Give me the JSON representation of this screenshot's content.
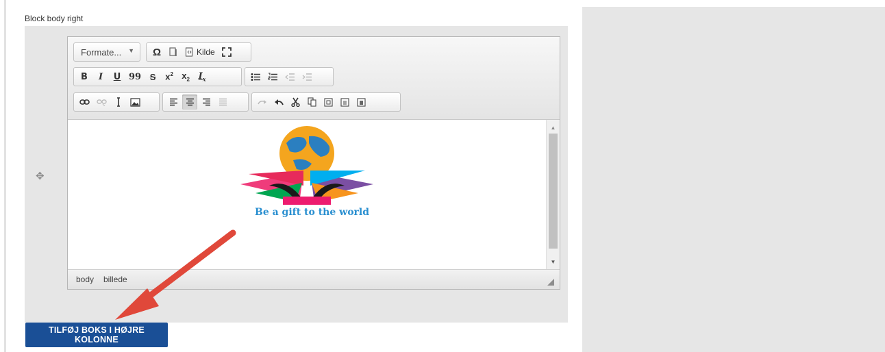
{
  "field_label": "Block body right",
  "toolbar": {
    "format_combo": "Formate...",
    "source_label": "Kilde",
    "row1": [
      "Ω",
      "⎗",
      "⛶"
    ],
    "row2": [
      "B",
      "I",
      "U",
      "99",
      "S",
      "x²",
      "x₂",
      "Ix"
    ],
    "row3": [
      "🔗",
      "⊘",
      "⚓",
      "🖼"
    ]
  },
  "content": {
    "logo_caption": "Be a gift to the world"
  },
  "statusbar": {
    "path": [
      "body",
      "billede"
    ]
  },
  "add_button": "TILFØJ BOKS I HØJRE KOLONNE",
  "colors": {
    "button_bg": "#1a4f96",
    "arrow": "#e0483a",
    "panel_bg": "#e6e6e6",
    "caption_blue": "#2a8fd0"
  }
}
